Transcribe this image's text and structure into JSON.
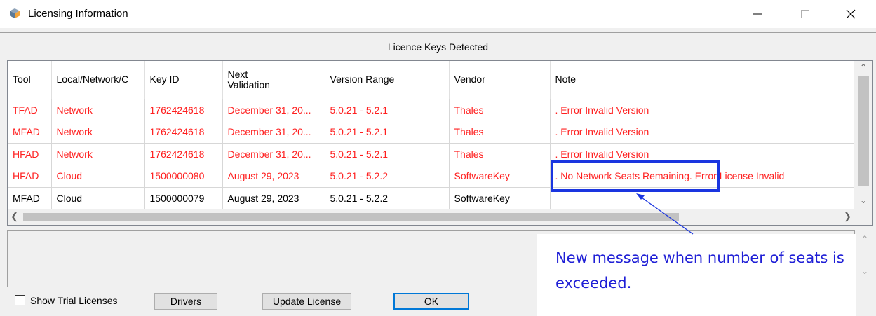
{
  "window": {
    "title": "Licensing Information"
  },
  "header": {
    "text": "Licence Keys Detected"
  },
  "table": {
    "columns": [
      "Tool",
      "Local/Network/C",
      "Key ID",
      "Next\nValidation",
      "Version Range",
      "Vendor",
      "Note"
    ],
    "rows": [
      {
        "status": "error",
        "cells": [
          "TFAD",
          "Network",
          "1762424618",
          "December 31, 20...",
          "5.0.21 - 5.2.1",
          "Thales",
          ". Error Invalid Version"
        ]
      },
      {
        "status": "error",
        "cells": [
          "MFAD",
          "Network",
          "1762424618",
          "December 31, 20...",
          "5.0.21 - 5.2.1",
          "Thales",
          ". Error Invalid Version"
        ]
      },
      {
        "status": "error",
        "cells": [
          "HFAD",
          "Network",
          "1762424618",
          "December 31, 20...",
          "5.0.21 - 5.2.1",
          "Thales",
          ". Error Invalid Version"
        ]
      },
      {
        "status": "error",
        "cells": [
          "HFAD",
          "Cloud",
          "1500000080",
          "August 29, 2023",
          "5.0.21 - 5.2.2",
          "SoftwareKey",
          ". No Network Seats Remaining. Error License Invalid"
        ]
      },
      {
        "status": "ok",
        "cells": [
          "MFAD",
          "Cloud",
          "1500000079",
          "August 29, 2023",
          "5.0.21 - 5.2.2",
          "SoftwareKey",
          ""
        ]
      }
    ]
  },
  "footer": {
    "trial_label": "Show Trial Licenses",
    "drivers_label": "Drivers",
    "update_label": "Update License",
    "ok_label": "OK"
  },
  "annotation": {
    "text": "New message when number of seats is exceeded."
  },
  "colors": {
    "error_text": "#ff1f1f",
    "annotation": "#1a35e0",
    "annotation_text": "#1f1fd6",
    "focus": "#0078d7"
  },
  "icons": {
    "app": "app-cube-icon",
    "minimize": "minimize-icon",
    "maximize": "maximize-icon",
    "close": "close-icon"
  }
}
